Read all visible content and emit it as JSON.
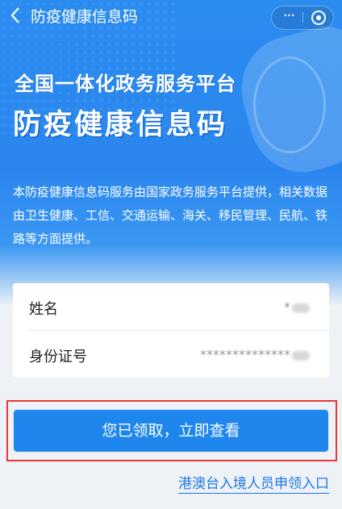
{
  "nav": {
    "title": "防疫健康信息码",
    "more_label": "···"
  },
  "hero": {
    "headline1": "全国一体化政务服务平台",
    "headline2": "防疫健康信息码",
    "description": "本防疫健康信息码服务由国家政务服务平台提供，相关数据由卫生健康、工信、交通运输、海关、移民管理、民航、铁路等方面提供。"
  },
  "form": {
    "name_label": "姓名",
    "name_value": "*",
    "id_label": "身份证号",
    "id_value": "**************"
  },
  "cta": {
    "label": "您已领取，立即查看"
  },
  "footer_link": {
    "label": "港澳台入境人员申领入口"
  },
  "colors": {
    "primary_blue": "#1f86ee",
    "highlight_red": "#e53935",
    "link_blue": "#1f78e0"
  }
}
